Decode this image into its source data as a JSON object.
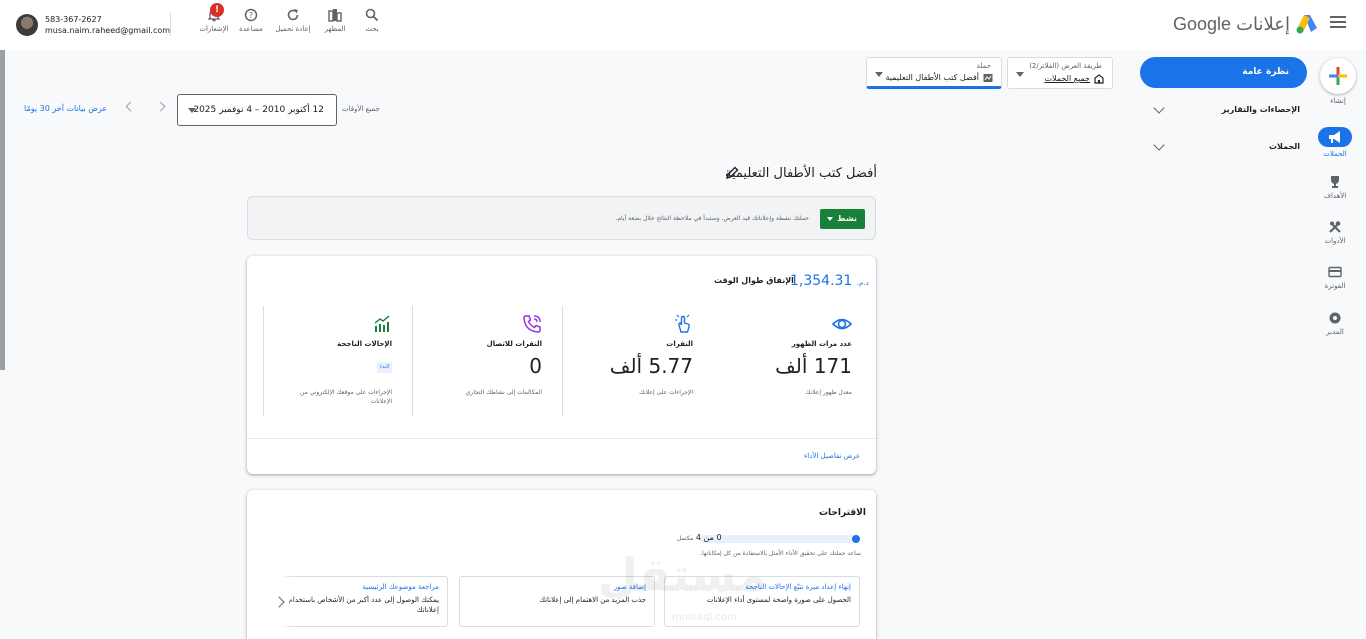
{
  "header": {
    "brand_google": "Google",
    "brand_product": "إعلانات",
    "tools": {
      "search": "بحث",
      "appearance": "المظهر",
      "refresh": "إعادة تحميل",
      "help": "مساعدة",
      "notifications": "الإشعارات",
      "notifications_badge": "!"
    },
    "account": {
      "phone": "583-367-2627",
      "email": "musa.naim.raheed@gmail.com"
    }
  },
  "rail": {
    "create": "إنشاء",
    "campaigns": "الحملات",
    "goals": "الأهداف",
    "tools": "الأدوات",
    "billing": "الفوترة",
    "admin": "المدير",
    "active_color": "#1a73e8"
  },
  "nav": {
    "overview": "نظرة عامة",
    "stats_reports": "الإحصاءات والتقارير",
    "campaigns": "الحملات"
  },
  "selectors": {
    "view_mode_label": "طريقة العرض (الفلاتر/2)",
    "view_mode_value": "جميع الحملات",
    "campaign_label": "حملة",
    "campaign_value": "أفضل كتب الأطفال التعليمية"
  },
  "date": {
    "all_time": "جميع الأوقات",
    "range": "12 أكتوبر 2010 – 4 نوفمبر 2025",
    "last30": "عرض بيانات آخر 30 يومًا"
  },
  "campaign": {
    "title": "أفضل كتب الأطفال التعليمية"
  },
  "status": {
    "button": "نشط",
    "button_color": "#188038",
    "message": "حملتك نشطة وإعلاناتك قيد العرض. وستبدأ في ملاحظة النتائج خلال بضعة أيام."
  },
  "performance": {
    "spend_label": "الإنفاق طوال الوقت",
    "spend_value": "1,354.31",
    "spend_currency": "د.م.",
    "metrics": [
      {
        "title": "عدد مرات الظهور",
        "value": "171 ألف",
        "sub": "معدل ظهور إعلانك",
        "icon": "eye-icon"
      },
      {
        "title": "النقرات",
        "value": "5.77 ألف",
        "sub": "الإجراءات على إعلانك",
        "icon": "tap-icon"
      },
      {
        "title": "النقرات للاتصال",
        "value": "0",
        "sub": "المكالمات إلى نشاطك التجاري",
        "icon": "phone-call-icon"
      },
      {
        "title": "الإحالات الناجحة",
        "value": "",
        "sub": "الإجراءات على موقعك الإلكتروني من الإعلانات",
        "chip": "البدء",
        "icon": "trend-chart-icon"
      }
    ],
    "details_link": "عرض تفاصيل الأداء"
  },
  "suggestions": {
    "title": "الاقتراحات",
    "progress_text": "0 من 4",
    "progress_sub": "مكتمل",
    "progress_fraction": 0,
    "description": "ساعد حملتك على تحقيق الأداء الأمثل بالاستفادة من كل إمكاناتها.",
    "cards": [
      {
        "title": "إنهاء إعداد ميزة تتبّع الإحالات الناجحة",
        "desc": "الحصول على صورة واضحة لمستوى أداء الإعلانات"
      },
      {
        "title": "إضافة صور",
        "desc": "جذب المزيد من الاهتمام إلى إعلاناتك"
      },
      {
        "title": "مراجعة موضوعك الرئيسية",
        "desc": "يمكنك الوصول إلى عدد أكبر من الأشخاص باستخدام إعلاناتك"
      }
    ]
  },
  "watermark": {
    "text": "مستقل",
    "sub": "mostaql.com"
  }
}
